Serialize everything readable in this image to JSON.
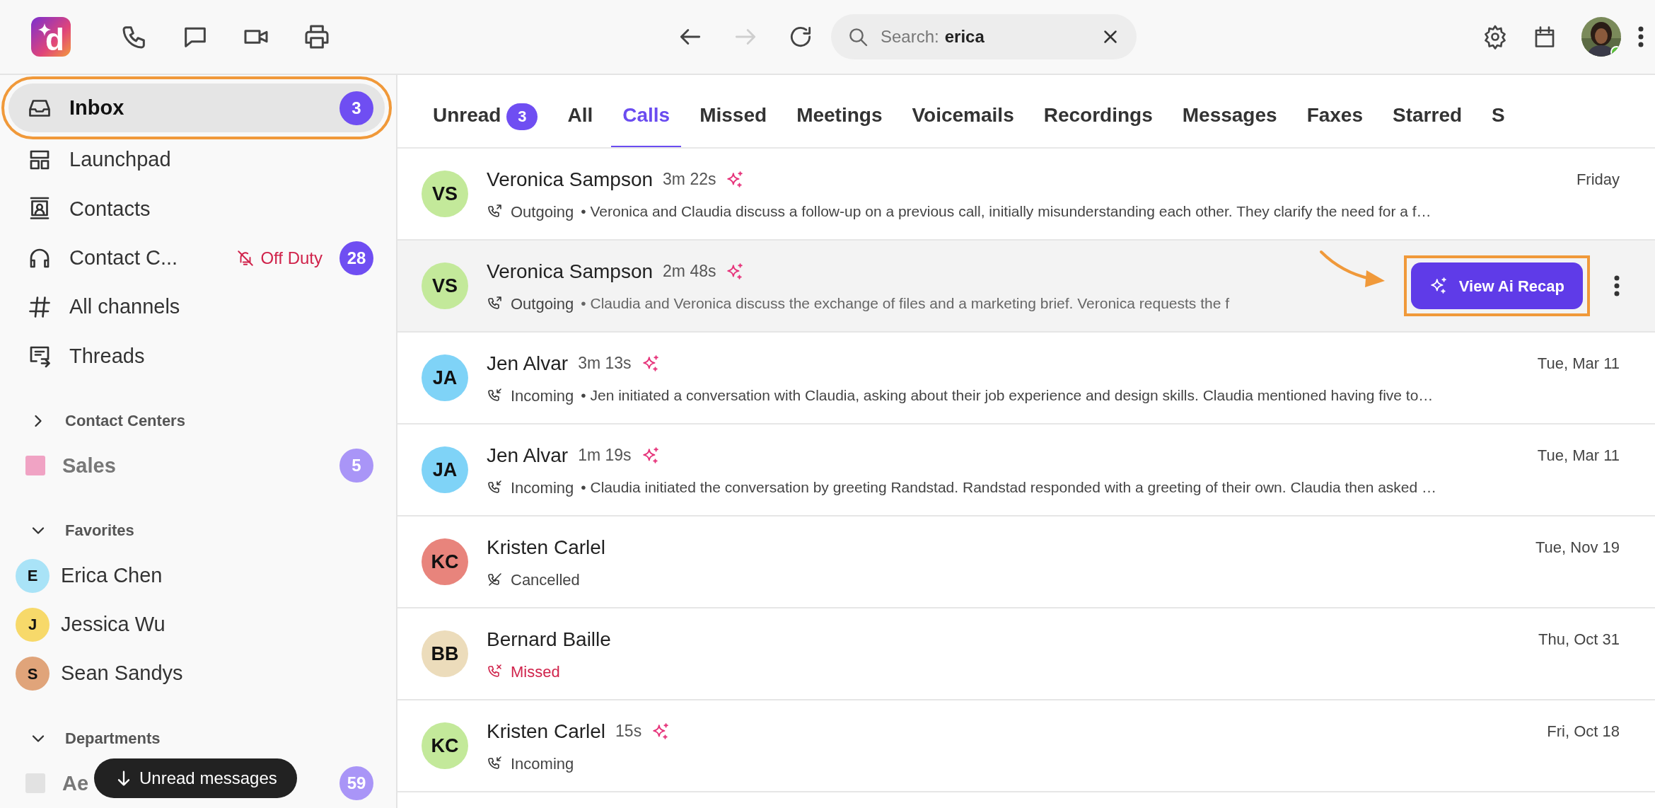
{
  "logo": {
    "text": "d"
  },
  "toolbar": {
    "back": {
      "disabled": false
    },
    "forward": {
      "disabled": true
    },
    "search": {
      "label": "Search:",
      "value": "erica"
    },
    "user": {
      "online": true
    }
  },
  "sidebar": {
    "nav": [
      {
        "label": "Inbox",
        "selected": true,
        "annotated": true,
        "count": "3"
      },
      {
        "label": "Launchpad",
        "selected": false,
        "annotated": false
      },
      {
        "label": "Contacts",
        "selected": false,
        "annotated": false
      },
      {
        "label": "Contact C...",
        "selected": false,
        "annotated": false,
        "status": "Off Duty",
        "count": "28"
      },
      {
        "label": "All channels",
        "selected": false,
        "annotated": false
      },
      {
        "label": "Threads",
        "selected": false,
        "annotated": false
      }
    ],
    "sections": [
      {
        "title": "Contact Centers",
        "expanded": false,
        "items": [
          {
            "kind": "square",
            "label": "Sales",
            "color": "#f0a3c4",
            "muted": true,
            "count": "5"
          }
        ]
      },
      {
        "title": "Favorites",
        "expanded": true,
        "items": [
          {
            "kind": "avatar",
            "initial": "E",
            "label": "Erica Chen",
            "color": "#a9e3f7",
            "muted": false
          },
          {
            "kind": "avatar",
            "initial": "J",
            "label": "Jessica Wu",
            "color": "#f7d96a",
            "muted": false
          },
          {
            "kind": "avatar",
            "initial": "S",
            "label": "Sean Sandys",
            "color": "#e0a47a",
            "muted": false
          }
        ]
      },
      {
        "title": "Departments",
        "expanded": true,
        "items": [
          {
            "kind": "square",
            "label": "Ae",
            "color": "#e2e2e2",
            "muted": true,
            "count": "59"
          }
        ]
      }
    ],
    "toast": "Unread messages"
  },
  "tabs": [
    {
      "label": "Unread",
      "selected": false,
      "count": "3"
    },
    {
      "label": "All",
      "selected": false
    },
    {
      "label": "Calls",
      "selected": true
    },
    {
      "label": "Missed",
      "selected": false
    },
    {
      "label": "Meetings",
      "selected": false
    },
    {
      "label": "Voicemails",
      "selected": false
    },
    {
      "label": "Recordings",
      "selected": false
    },
    {
      "label": "Messages",
      "selected": false
    },
    {
      "label": "Faxes",
      "selected": false
    },
    {
      "label": "Starred",
      "selected": false
    },
    {
      "label": "S",
      "selected": false
    }
  ],
  "calls": [
    {
      "initials": "VS",
      "color": "#c3e99a",
      "name": "Veronica Sampson",
      "duration": "3m 22s",
      "ai": true,
      "kind": "outgoing",
      "status": "Outgoing",
      "summary": "• Veronica and Claudia discuss a follow-up on a previous call, initially misunderstanding each other. They clarify the need for a f…",
      "date": "Friday",
      "hovered": false
    },
    {
      "initials": "VS",
      "color": "#c3e99a",
      "name": "Veronica Sampson",
      "duration": "2m 48s",
      "ai": true,
      "kind": "outgoing",
      "status": "Outgoing",
      "summary": "• Claudia and Veronica discuss the exchange of files and a marketing brief. Veronica requests the f",
      "hovered": true,
      "action": {
        "label": "View Ai Recap",
        "annotated": true
      }
    },
    {
      "initials": "JA",
      "color": "#7fd3f7",
      "name": "Jen Alvar",
      "duration": "3m 13s",
      "ai": true,
      "kind": "incoming",
      "status": "Incoming",
      "summary": "• Jen initiated a conversation with Claudia, asking about their job experience and design skills. Claudia mentioned having five to…",
      "date": "Tue, Mar 11",
      "hovered": false
    },
    {
      "initials": "JA",
      "color": "#7fd3f7",
      "name": "Jen Alvar",
      "duration": "1m 19s",
      "ai": true,
      "kind": "incoming",
      "status": "Incoming",
      "summary": "• Claudia initiated the conversation by greeting Randstad. Randstad responded with a greeting of their own. Claudia then asked …",
      "date": "Tue, Mar 11",
      "hovered": false
    },
    {
      "initials": "KC",
      "color": "#e8847c",
      "name": "Kristen Carlel",
      "ai": false,
      "kind": "cancelled",
      "status": "Cancelled",
      "date": "Tue, Nov 19",
      "hovered": false
    },
    {
      "initials": "BB",
      "color": "#ecdcbb",
      "name": "Bernard Baille",
      "ai": false,
      "kind": "missed",
      "status": "Missed",
      "date": "Thu, Oct 31",
      "hovered": false
    },
    {
      "initials": "KC",
      "color": "#c3e99a",
      "name": "Kristen Carlel",
      "duration": "15s",
      "ai": true,
      "kind": "incoming",
      "status": "Incoming",
      "date": "Fri, Oct 18",
      "hovered": false
    }
  ]
}
